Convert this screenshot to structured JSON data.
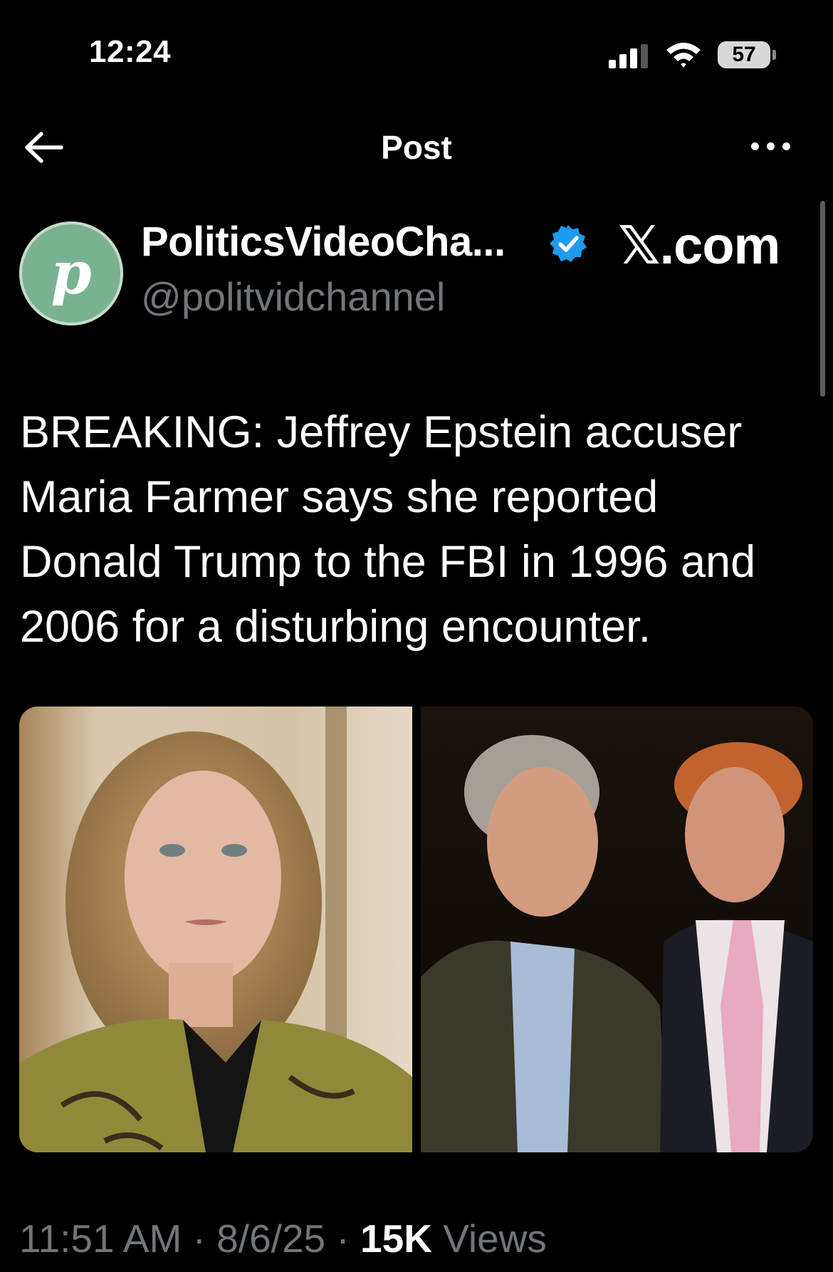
{
  "status_bar": {
    "time": "12:24",
    "battery": "57"
  },
  "header": {
    "title": "Post",
    "back_icon": "arrow-left-icon",
    "more_icon": "more-horizontal-icon"
  },
  "author": {
    "avatar_letter": "p",
    "display_name": "PoliticsVideoCha...",
    "handle": "@politvidchannel",
    "verified": true
  },
  "watermark": "𝕏.com",
  "post": {
    "text": "BREAKING: Jeffrey Epstein accuser Maria Farmer says she reported Donald Trump to the FBI in 1996 and 2006 for a disturbing encounter."
  },
  "meta": {
    "time": "11:51 AM",
    "separator": " · ",
    "date": "8/6/25",
    "views_count": "15K",
    "views_label": " Views"
  },
  "colors": {
    "background": "#000000",
    "text": "#ffffff",
    "secondary": "#71767b",
    "verified": "#1d9bf0",
    "avatar": "#79b290"
  }
}
